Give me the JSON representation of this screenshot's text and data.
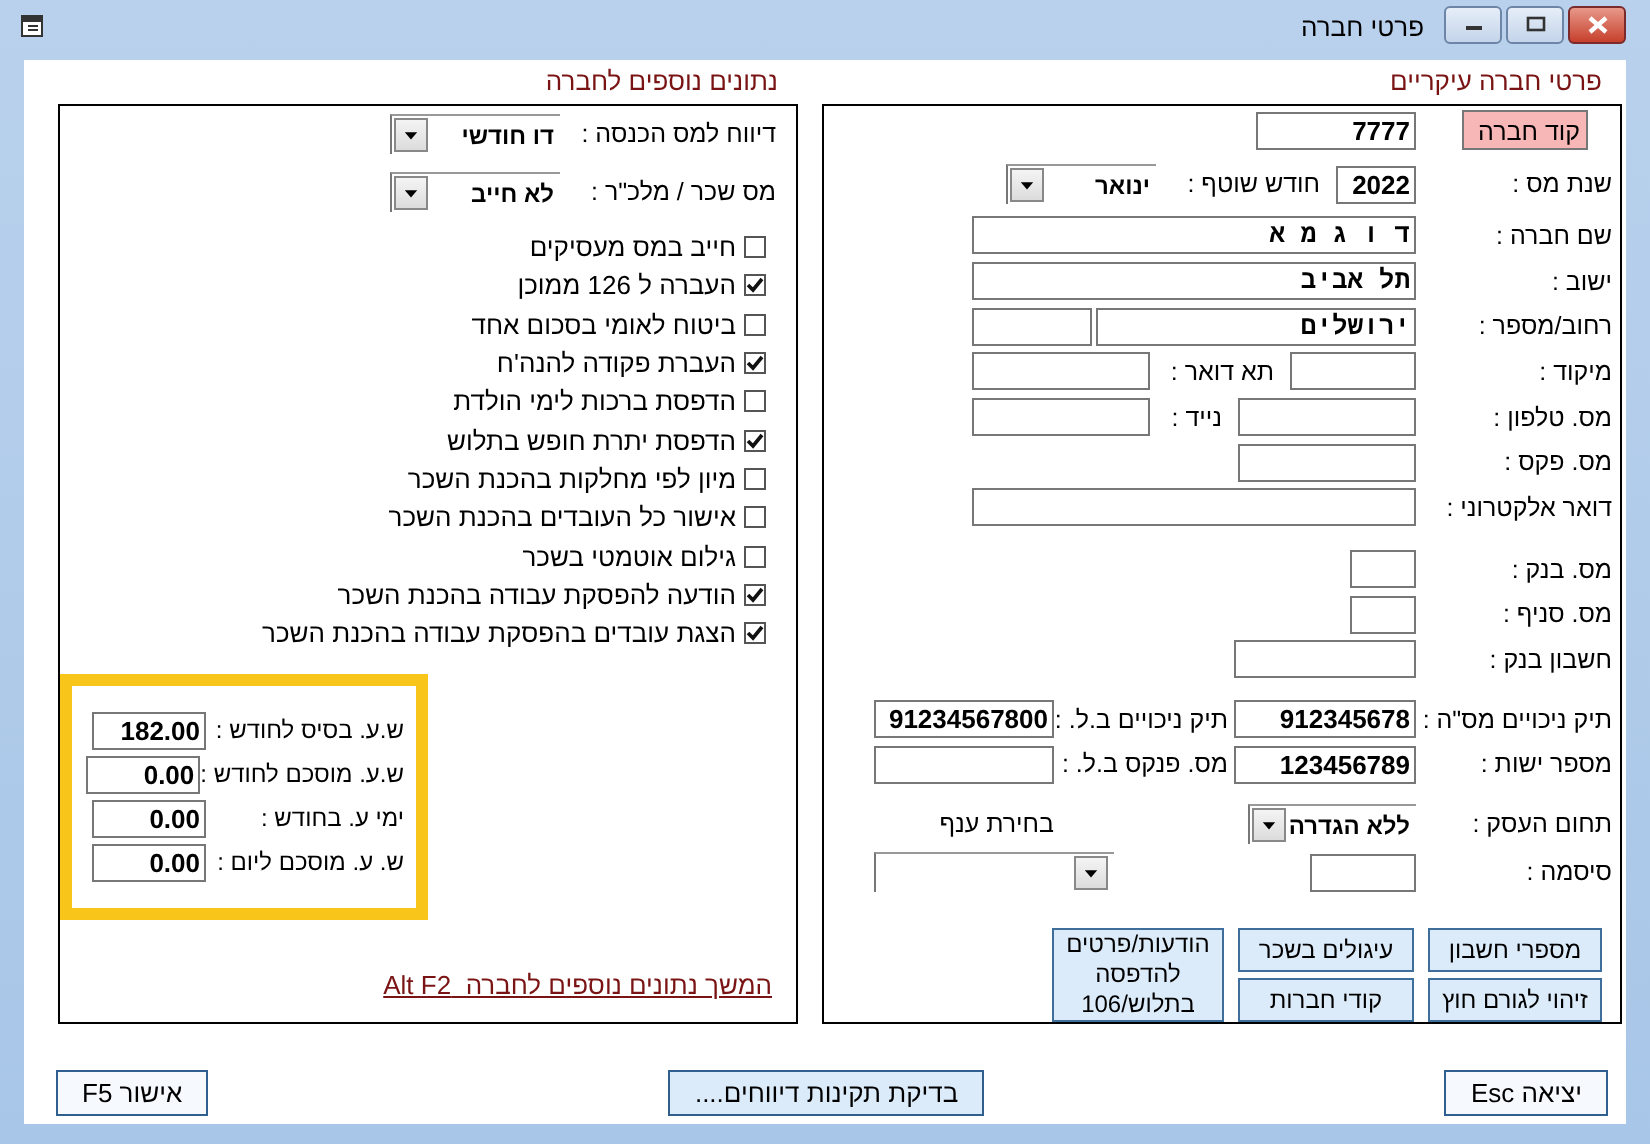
{
  "window": {
    "title": "פרטי חברה"
  },
  "main": {
    "heading": "פרטי חברה עיקריים",
    "company_code": {
      "label": "קוד חברה",
      "value": "7777"
    },
    "tax_year": {
      "label": "שנת מס :",
      "value": "2022"
    },
    "current_month": {
      "label": "חודש שוטף :",
      "value": "ינואר"
    },
    "company_name": {
      "label": "שם חברה :",
      "value": "ד ו ג מ א"
    },
    "city": {
      "label": "ישוב :",
      "value": "תל אביב"
    },
    "street": {
      "label": "רחוב/מספר :",
      "value": "ירושלים"
    },
    "zip": {
      "label": "מיקוד :"
    },
    "po_box": {
      "label": "תא דואר :"
    },
    "phone": {
      "label": "מס. טלפון :"
    },
    "mobile": {
      "label": "נייד :"
    },
    "fax": {
      "label": "מס. פקס :"
    },
    "email": {
      "label": "דואר אלקטרוני :"
    },
    "bank": {
      "label": "מס. בנק :"
    },
    "branch": {
      "label": "מס. סניף :"
    },
    "account": {
      "label": "חשבון בנק :"
    },
    "tax_file": {
      "label": "תיק ניכויים מס\"ה :",
      "value": "912345678"
    },
    "ni_file": {
      "label": "תיק ניכויים ב.ל. :",
      "value": "91234567800"
    },
    "entity_no": {
      "label": "מספר ישות :",
      "value": "123456789"
    },
    "ni_book": {
      "label": "מס. פנקס ב.ל. :"
    },
    "business": {
      "label": "תחום העסק :",
      "value": "ללא הגדרה"
    },
    "branch_pick": {
      "label": "בחירת ענף"
    },
    "password": {
      "label": "סיסמה :"
    },
    "buttons": [
      {
        "label": "מספרי חשבון"
      },
      {
        "label": "זיהוי לגורם חוץ"
      },
      {
        "label": "עיגולים בשכר"
      },
      {
        "label": "קודי חברות"
      },
      {
        "label": "הודעות/פרטים להדפסה בתלוש/106"
      }
    ]
  },
  "extra": {
    "heading": "נתונים נוספים לחברה",
    "income_tax_report": {
      "label": "דיווח למס הכנסה :",
      "value": "דו חודשי"
    },
    "wage_tax": {
      "label": "מס שכר / מלכ\"ר :",
      "value": "לא חייב"
    },
    "options": [
      {
        "label": "חייב במס מעסיקים",
        "checked": false
      },
      {
        "label": "העברה ל 126 ממוכן",
        "checked": true
      },
      {
        "label": "ביטוח לאומי בסכום אחד",
        "checked": false
      },
      {
        "label": "העברת פקודה להנה'ח",
        "checked": true
      },
      {
        "label": "הדפסת ברכות לימי הולדת",
        "checked": false
      },
      {
        "label": "הדפסת יתרת חופש בתלוש",
        "checked": true
      },
      {
        "label": "מיון לפי מחלקות בהכנת השכר",
        "checked": false
      },
      {
        "label": "אישור כל העובדים בהכנת השכר",
        "checked": false
      },
      {
        "label": "גילום אוטמטי בשכר",
        "checked": false
      },
      {
        "label": "הודעה להפסקת עבודה בהכנת השכר",
        "checked": true
      },
      {
        "label": "הצגת עובדים בהפסקת עבודה בהכנת השכר",
        "checked": true
      }
    ],
    "hours": [
      {
        "label": "ש.ע. בסיס לחודש :",
        "value": "182.00"
      },
      {
        "label": "ש.ע. מוסכם לחודש :",
        "value": "0.00"
      },
      {
        "label": "ימי ע. בחודש :",
        "value": "0.00"
      },
      {
        "label": "ש. ע. מוסכם ליום :",
        "value": "0.00"
      }
    ],
    "link": "המשך נתונים נוספים לחברה  Alt F2"
  },
  "footer": [
    {
      "label": "יציאה Esc",
      "kind": "plain"
    },
    {
      "label": "בדיקת תקינות דיווחים....",
      "kind": "accent"
    },
    {
      "label": "אישור F5",
      "kind": "plain"
    }
  ]
}
